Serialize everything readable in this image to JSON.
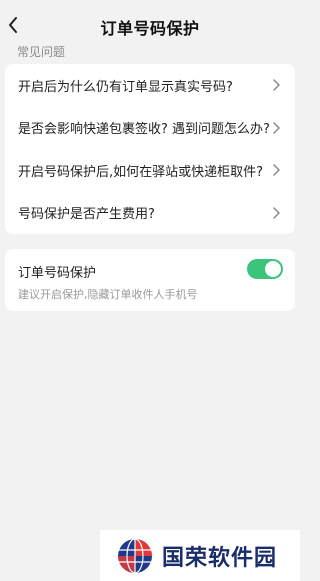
{
  "header": {
    "title": "订单号码保护"
  },
  "faq": {
    "section_label": "常见问题",
    "items": [
      {
        "label": "开启后为什么仍有订单显示真实号码?"
      },
      {
        "label": "是否会影响快递包裹签收? 遇到问题怎么办?"
      },
      {
        "label": "开启号码保护后,如何在驿站或快递柜取件?"
      },
      {
        "label": "号码保护是否产生费用?"
      }
    ]
  },
  "protection": {
    "title": "订单号码保护",
    "subtitle": "建议开启保护,隐藏订单收件人手机号",
    "enabled": true,
    "switch_color": "#3cc47c"
  },
  "watermark": {
    "text": "国荣软件园"
  },
  "icons": {
    "back": "chevron-left-icon",
    "row_arrow": "chevron-right-icon"
  }
}
